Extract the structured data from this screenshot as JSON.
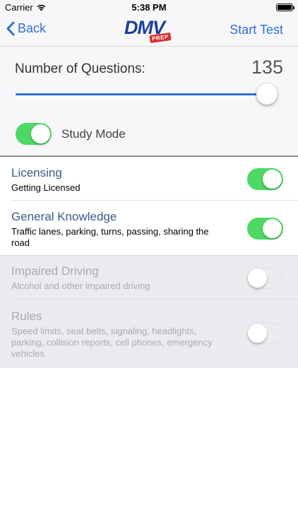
{
  "status_bar": {
    "carrier": "Carrier",
    "time": "5:38 PM"
  },
  "nav": {
    "back_label": "Back",
    "logo_text": "DMV",
    "logo_badge": "PREP",
    "start_label": "Start Test"
  },
  "settings": {
    "questions_label": "Number of Questions:",
    "questions_value": "135",
    "slider_fraction": 1.0,
    "study_mode_label": "Study Mode",
    "study_mode_on": true
  },
  "categories": [
    {
      "title": "Licensing",
      "description": "Getting Licensed",
      "enabled": true
    },
    {
      "title": "General Knowledge",
      "description": "Traffic lanes, parking, turns, passing, sharing the road",
      "enabled": true
    },
    {
      "title": "Impaired Driving",
      "description": "Alcohol and other impaired driving",
      "enabled": false
    },
    {
      "title": "Rules",
      "description": "Speed limits, seat belts, signaling, headlights, parking, collision reports, cell phones, emergency vehicles",
      "enabled": false
    }
  ],
  "colors": {
    "accent": "#2f6fd8",
    "toggle_on": "#4cd964",
    "logo": "#1b3f9c",
    "badge": "#d83030"
  }
}
